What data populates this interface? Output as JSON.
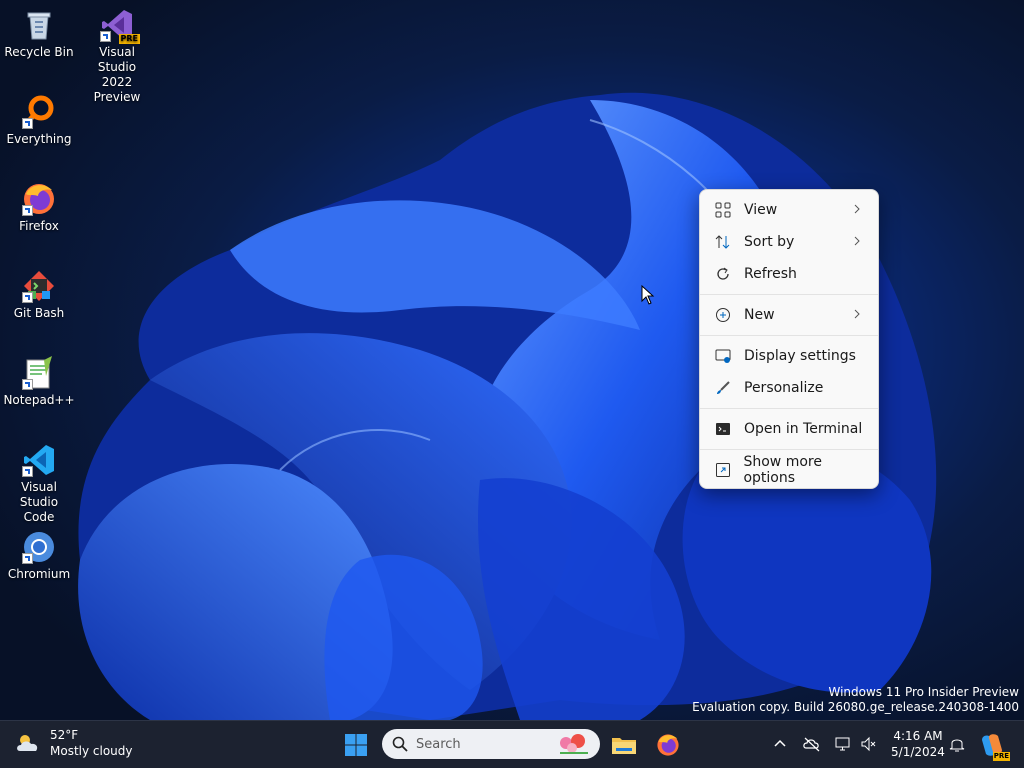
{
  "desktop": {
    "icons": [
      {
        "label": "Recycle Bin",
        "icon": "recycle-bin-icon"
      },
      {
        "label": "Visual Studio 2022 Preview",
        "line1": "Visual Studio",
        "line2": "2022 Preview",
        "icon": "visual-studio-icon",
        "badge": "PRE"
      },
      {
        "label": "Everything",
        "icon": "everything-icon"
      },
      {
        "label": "Firefox",
        "icon": "firefox-icon"
      },
      {
        "label": "Git Bash",
        "icon": "git-bash-icon"
      },
      {
        "label": "Notepad++",
        "icon": "notepad-plus-plus-icon"
      },
      {
        "label": "Visual Studio Code",
        "line1": "Visual Studio",
        "line2": "Code",
        "icon": "vscode-icon"
      },
      {
        "label": "Chromium",
        "icon": "chromium-icon"
      }
    ]
  },
  "context_menu": {
    "items": [
      {
        "label": "View",
        "icon": "grid-view-icon",
        "submenu": true
      },
      {
        "label": "Sort by",
        "icon": "sort-icon",
        "submenu": true
      },
      {
        "label": "Refresh",
        "icon": "refresh-icon",
        "submenu": false
      },
      {
        "label": "New",
        "icon": "plus-circle-icon",
        "submenu": true
      },
      {
        "label": "Display settings",
        "icon": "display-settings-icon",
        "submenu": false
      },
      {
        "label": "Personalize",
        "icon": "brush-icon",
        "submenu": false
      },
      {
        "label": "Open in Terminal",
        "icon": "terminal-icon",
        "submenu": false
      },
      {
        "label": "Show more options",
        "icon": "more-options-icon",
        "submenu": false
      }
    ]
  },
  "watermark": {
    "line1": "Windows 11 Pro Insider Preview",
    "line2": "Evaluation copy. Build 26080.ge_release.240308-1400"
  },
  "taskbar": {
    "weather": {
      "temp": "52°F",
      "condition": "Mostly cloudy"
    },
    "search_placeholder": "Search",
    "clock": {
      "time": "4:16 AM",
      "date": "5/1/2024"
    },
    "copilot_badge": "PRE"
  },
  "colors": {
    "accent": "#0067c0",
    "taskbar": "#1c2230",
    "menu_bg": "#f9f9f9"
  }
}
